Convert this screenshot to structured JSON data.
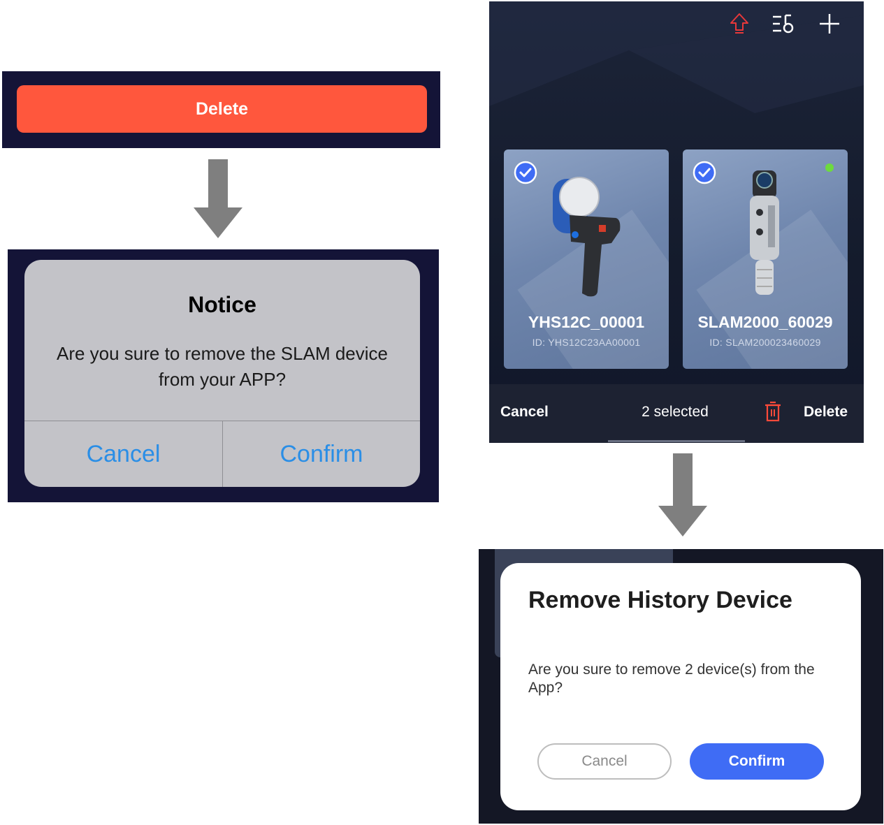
{
  "left_flow": {
    "delete_button_label": "Delete",
    "notice_dialog": {
      "title": "Notice",
      "message": "Are you sure to remove the SLAM device from your APP?",
      "cancel_label": "Cancel",
      "confirm_label": "Confirm"
    }
  },
  "right_flow": {
    "top_icons": [
      "upload-icon",
      "filter-icon",
      "add-icon"
    ],
    "devices": [
      {
        "name": "YHS12C_00001",
        "id": "ID:  YHS12C23AA00001",
        "selected": true,
        "online": false
      },
      {
        "name": "SLAM2000_60029",
        "id": "ID:  SLAM200023460029",
        "selected": true,
        "online": true
      }
    ],
    "bottom_bar": {
      "cancel_label": "Cancel",
      "selected_text": "2 selected",
      "delete_label": "Delete"
    },
    "remove_dialog": {
      "title": "Remove History Device",
      "message": "Are you sure to remove 2 device(s) from the App?",
      "cancel_label": "Cancel",
      "confirm_label": "Confirm"
    }
  },
  "colors": {
    "delete_red": "#ff573d",
    "confirm_blue": "#3f6cf5",
    "ios_blue": "#2a8ee6",
    "online_green": "#6ddb3e",
    "panel_navy": "#141437"
  }
}
